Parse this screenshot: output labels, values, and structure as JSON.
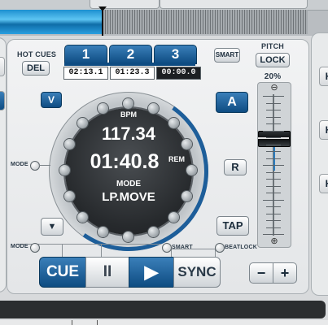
{
  "hot_cues": {
    "title": "HOT CUES",
    "del_label": "DEL",
    "buttons": [
      "1",
      "2",
      "3"
    ],
    "times": [
      "02:13.1",
      "01:23.3",
      "00:00.0"
    ]
  },
  "smart_label": "SMART",
  "pitch": {
    "title": "PITCH",
    "lock_label": "LOCK",
    "range": "20%",
    "minus_symbol": "⊖",
    "plus_symbol": "⊕"
  },
  "deck_buttons": {
    "v_label": "V",
    "a_label": "A",
    "r_label": "R",
    "tap_label": "TAP",
    "eject_symbol": "▼"
  },
  "jog": {
    "bpm_label": "BPM",
    "bpm_value": "117.34",
    "time_value": "01:40.8",
    "rem_label": "REM",
    "mode_label": "MODE",
    "mode_value": "LP.MOVE"
  },
  "labels": {
    "mode_side": "MODE",
    "mode_bottom": "MODE",
    "smart_bottom": "SMART",
    "beatlock": "BEATLOCK"
  },
  "transport": {
    "cue": "CUE",
    "pause": "II",
    "play": "▶",
    "sync": "SYNC"
  },
  "nudge": {
    "minus": "−",
    "plus": "+"
  },
  "side_buttons": {
    "right": [
      "H",
      "H",
      "H"
    ]
  },
  "colors": {
    "accent_blue": "#0e4c82",
    "wave_blue": "#1c8fd0",
    "jog_face": "#26292c"
  }
}
